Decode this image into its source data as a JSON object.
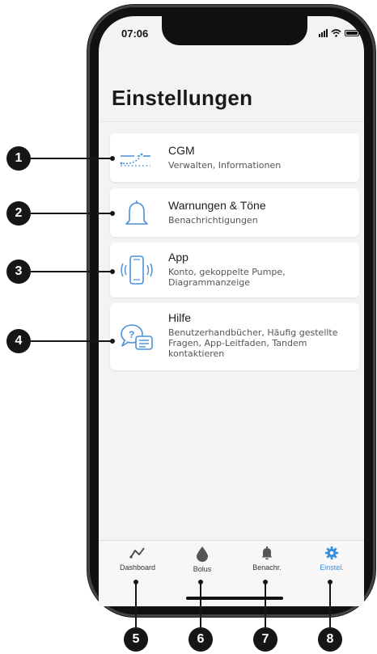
{
  "status": {
    "time": "07:06"
  },
  "page_title": "Einstellungen",
  "items": [
    {
      "icon": "cgm-icon",
      "title": "CGM",
      "subtitle": "Verwalten, Informationen"
    },
    {
      "icon": "bell-icon",
      "title": "Warnungen & Töne",
      "subtitle": "Benachrichtigungen"
    },
    {
      "icon": "phone-icon",
      "title": "App",
      "subtitle": "Konto, gekoppelte Pumpe, Diagrammanzeige"
    },
    {
      "icon": "help-chat-icon",
      "title": "Hilfe",
      "subtitle": "Benutzerhandbücher, Häufig gestellte Fragen, App-Leitfaden, Tandem kontaktieren"
    }
  ],
  "tabs": [
    {
      "label": "Dashboard",
      "icon": "dashboard-icon"
    },
    {
      "label": "Bolus",
      "icon": "drop-icon"
    },
    {
      "label": "Benachr.",
      "icon": "bell-icon"
    },
    {
      "label": "Einstel.",
      "icon": "gear-icon",
      "active": true
    }
  ],
  "callouts": [
    "1",
    "2",
    "3",
    "4",
    "5",
    "6",
    "7",
    "8"
  ],
  "colors": {
    "accent": "#3b8fd9",
    "icon_blue": "#4a90d9",
    "dark": "#161616"
  }
}
